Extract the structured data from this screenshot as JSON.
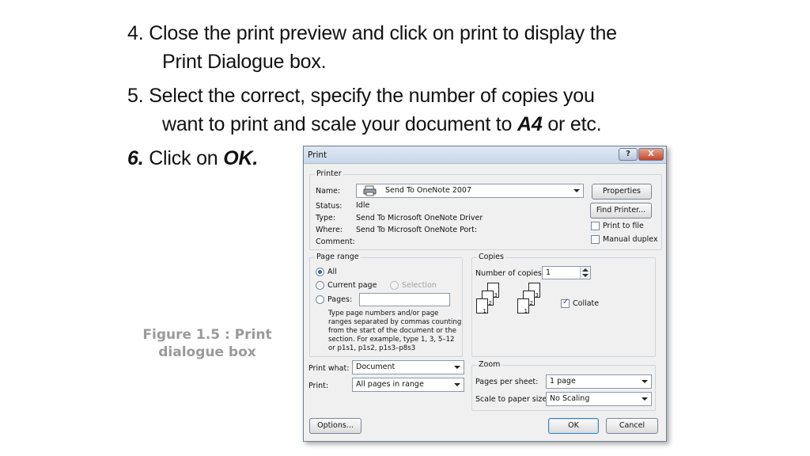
{
  "slide": {
    "step4": {
      "line1": "4. Close the print preview and click on print to display the",
      "line2": "Print Dialogue box."
    },
    "step5": {
      "line1": "5.  Select the correct, specify the number of copies you",
      "line2_pre": "want to print and scale your document to ",
      "line2_bold": "A4",
      "line2_post": " or etc."
    },
    "step6": {
      "num": "6.",
      "text": " Click on ",
      "bold": "OK."
    },
    "caption": {
      "line1": "Figure 1.5 : Print",
      "line2": "dialogue box"
    }
  },
  "dialog": {
    "title": "Print",
    "help_label": "?",
    "close_label": "X",
    "printer": {
      "legend": "Printer",
      "name_label": "Name:",
      "name_value": "Send To OneNote 2007",
      "status_label": "Status:",
      "status_value": "Idle",
      "type_label": "Type:",
      "type_value": "Send To Microsoft OneNote Driver",
      "where_label": "Where:",
      "where_value": "Send To Microsoft OneNote Port:",
      "comment_label": "Comment:",
      "properties_button": "Properties",
      "find_printer_button": "Find Printer...",
      "print_to_file": "Print to file",
      "manual_duplex": "Manual duplex"
    },
    "page_range": {
      "legend": "Page range",
      "all": "All",
      "current_page": "Current page",
      "selection": "Selection",
      "pages": "Pages:",
      "help": "Type page numbers and/or page ranges separated by commas counting from the start of the document or the section. For example, type 1, 3, 5–12 or p1s1, p1s2, p1s3–p8s3"
    },
    "copies": {
      "legend": "Copies",
      "number_label": "Number of copies:",
      "number_value": "1",
      "collate": "Collate",
      "page_numbers": [
        "3",
        "2",
        "1",
        "3",
        "2",
        "1"
      ]
    },
    "print_what_label": "Print what:",
    "print_what_value": "Document",
    "print_label": "Print:",
    "print_value": "All pages in range",
    "zoom": {
      "legend": "Zoom",
      "pages_per_sheet_label": "Pages per sheet:",
      "pages_per_sheet_value": "1 page",
      "scale_label": "Scale to paper size:",
      "scale_value": "No Scaling"
    },
    "options_button": "Options...",
    "ok_button": "OK",
    "cancel_button": "Cancel"
  }
}
